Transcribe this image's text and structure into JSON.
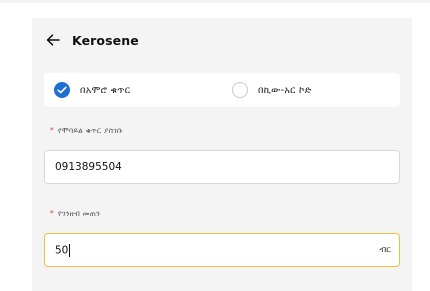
{
  "header": {
    "title": "Kerosene"
  },
  "payment_type": {
    "options": [
      {
        "label": "በአሞሮ ቁጥር",
        "selected": true
      },
      {
        "label": "በኪው-አር ኮድ",
        "selected": false
      }
    ]
  },
  "phone_field": {
    "label": "የሞባይል ቁጥር ያስገቡ",
    "required_mark": "*",
    "value": "0913895504"
  },
  "amount_field": {
    "label": "የገንዘብ መጠን",
    "required_mark": "*",
    "value": "50",
    "suffix": "ብር"
  },
  "colors": {
    "accent": "#1f6fd1",
    "focus_border": "#f0c13c",
    "required": "#e0463a",
    "panel_bg": "#f4f4f4"
  }
}
